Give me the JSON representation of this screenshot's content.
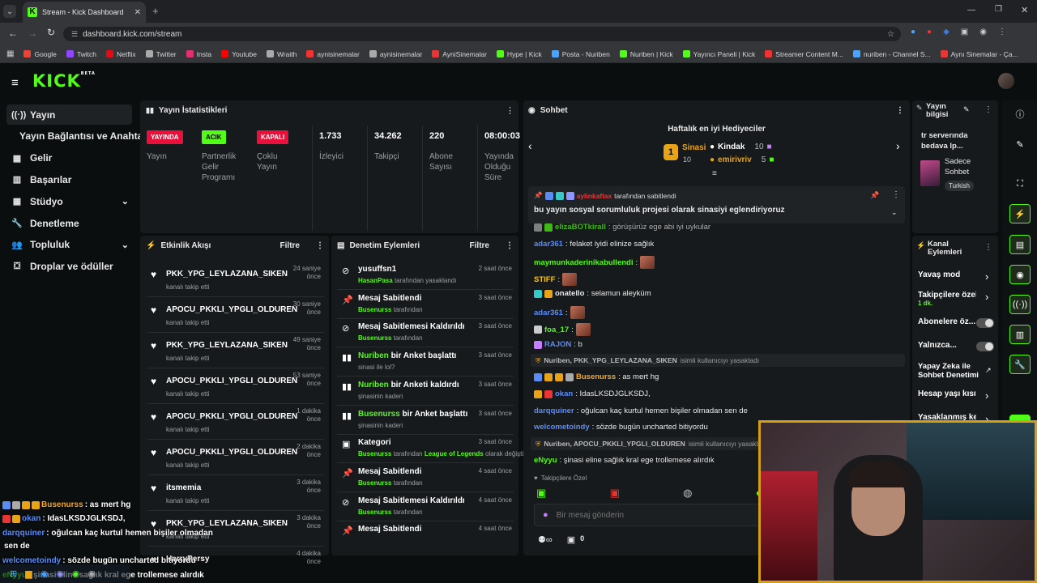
{
  "browser": {
    "tab_title": "Stream - Kick Dashboard",
    "url": "dashboard.kick.com/stream",
    "bookmarks": [
      "Google",
      "Twitch",
      "Netflix",
      "Twitter",
      "Insta",
      "Youtube",
      "Wraith",
      "aynisinemalar",
      "aynisinemalar",
      "AyniSinemalar",
      "Hype | Kick",
      "Posta - Nuriben",
      "Nuriben | Kick",
      "Yayıncı Paneli | Kick",
      "Streamer Content M...",
      "nuriben - Channel S...",
      "Aynı Sinemalar - Ça..."
    ]
  },
  "logo": {
    "text": "KICK",
    "beta": "BETA"
  },
  "sidebar": {
    "items": [
      {
        "label": "Yayın",
        "icon": "broadcast-icon"
      },
      {
        "label": "Yayın Bağlantısı ve Anahtarı",
        "icon": ""
      },
      {
        "label": "Gelir",
        "icon": "chart-icon"
      },
      {
        "label": "Başarılar",
        "icon": "trophy-icon"
      },
      {
        "label": "Stüdyo",
        "icon": "studio-icon"
      },
      {
        "label": "Denetleme",
        "icon": "wrench-icon"
      },
      {
        "label": "Topluluk",
        "icon": "people-icon"
      },
      {
        "label": "Droplar ve ödüller",
        "icon": "gift-icon"
      }
    ]
  },
  "stats": {
    "title": "Yayın İstatistikleri",
    "items": [
      {
        "tag": "YAYINDA",
        "label": "Yayın",
        "color": "#e9113c"
      },
      {
        "tag": "ACIK",
        "label": "Partnerlik Gelir Programı",
        "color": "#53fc18"
      },
      {
        "tag": "KAPALI",
        "label": "Çoklu Yayın",
        "color": "#e9113c"
      },
      {
        "value": "1.733",
        "label": "İzleyici"
      },
      {
        "value": "34.262",
        "label": "Takipçi"
      },
      {
        "value": "220",
        "label": "Abone Sayısı"
      },
      {
        "value": "08:00:03",
        "label": "Yayında Olduğu Süre"
      }
    ]
  },
  "activity": {
    "title": "Etkinlik Akışı",
    "filter": "Filtre",
    "events": [
      {
        "name": "PKK_YPG_LEYLAZANA_SIKEN",
        "sub": "kanalı takip etti",
        "time": "24 saniye önce"
      },
      {
        "name": "APOCU_PKKLI_YPGLI_OLDUREN",
        "sub": "kanalı takip etti",
        "time": "30 saniye önce"
      },
      {
        "name": "PKK_YPG_LEYLAZANA_SIKEN",
        "sub": "kanalı takip etti",
        "time": "49 saniye önce"
      },
      {
        "name": "APOCU_PKKLI_YPGLI_OLDUREN",
        "sub": "kanalı takip etti",
        "time": "53 saniye önce"
      },
      {
        "name": "APOCU_PKKLI_YPGLI_OLDUREN",
        "sub": "kanalı takip etti",
        "time": "1 dakika önce"
      },
      {
        "name": "APOCU_PKKLI_YPGLI_OLDUREN",
        "sub": "kanalı takip etti",
        "time": "2 dakika önce"
      },
      {
        "name": "itsmemia",
        "sub": "kanalı takip etti",
        "time": "3 dakika önce"
      },
      {
        "name": "PKK_YPG_LEYLAZANA_SIKEN",
        "sub": "kanalı takip etti",
        "time": "3 dakika önce"
      },
      {
        "name": "HarryPersy",
        "sub": "",
        "time": "4 dakika önce"
      }
    ]
  },
  "moderation": {
    "title": "Denetim Eylemleri",
    "filter": "Filtre",
    "actions": [
      {
        "icon": "ban-icon",
        "name": "yusuffsn1",
        "actor": "HasanPasa",
        "rest": "tarafından yasaklandı",
        "time": "2 saat önce"
      },
      {
        "icon": "pin-icon",
        "name": "Mesaj Sabitlendi",
        "actor": "Busenurss",
        "rest": "tarafından",
        "time": "3 saat önce"
      },
      {
        "icon": "unpin-icon",
        "name": "Mesaj Sabitlemesi Kaldırıldı",
        "actor": "Busenurss",
        "rest": "tarafından",
        "time": "3 saat önce"
      },
      {
        "icon": "poll-icon",
        "name": "bir Anket başlattı",
        "actor_name": "Nuriben",
        "sub": "sinasi ile lol?",
        "time": "3 saat önce"
      },
      {
        "icon": "poll-icon",
        "name": "bir Anketi kaldırdı",
        "actor_name": "Nuriben",
        "sub": "şinasinin kaderi",
        "time": "3 saat önce"
      },
      {
        "icon": "poll-icon",
        "name": "bir Anket başlattı",
        "actor_name": "Busenurss",
        "sub": "şinasinin kaderi",
        "time": "3 saat önce"
      },
      {
        "icon": "category-icon",
        "name": "Kategori",
        "actor": "Busenurss",
        "rest": "tarafından",
        "game": "League of Legends",
        "rest2": "olarak değiştirildi",
        "time": "3 saat önce"
      },
      {
        "icon": "pin-icon",
        "name": "Mesaj Sabitlendi",
        "actor": "Busenurss",
        "rest": "tarafından",
        "time": "4 saat önce"
      },
      {
        "icon": "unpin-icon",
        "name": "Mesaj Sabitlemesi Kaldırıldı",
        "actor": "Busenurss",
        "rest": "tarafından",
        "time": "4 saat önce"
      },
      {
        "icon": "pin-icon",
        "name": "Mesaj Sabitlendi",
        "actor": "",
        "rest": "",
        "time": "4 saat önce"
      }
    ]
  },
  "chat": {
    "title": "Sohbet",
    "gifters_title": "Haftalık en iyi Hediyeciler",
    "gifters": [
      {
        "name": "Sinasi",
        "count": "10"
      },
      {
        "name": "Kindak",
        "count": "10"
      },
      {
        "name": "emirivriv",
        "count": "5"
      }
    ],
    "pinned_by": "aylinkaflax",
    "pinned_by_rest": "tarafından sabitlendi",
    "pinned_text": "bu yayın sosyal sorumluluk projesi olarak sinasiyi eglendiriyoruz",
    "messages": [
      {
        "user": "elizaBOTkirall",
        "color": "#53fc18",
        "text": ": görüşürüz ege abi iyi uykular"
      },
      {
        "user": "adar361",
        "color": "#5b8cf5",
        "text": ": felaket iyidi elinize sağlık"
      },
      {
        "user": "maymunkaderinikabullendi",
        "color": "#53fc18",
        "text": ":"
      },
      {
        "user": "STIFF",
        "color": "#f5c518",
        "text": ":"
      },
      {
        "user": "onatello",
        "color": "#e8e8e8",
        "text": ": selamun aleyküm"
      },
      {
        "user": "adar361",
        "color": "#5b8cf5",
        "text": ":"
      },
      {
        "user": "foa_17",
        "color": "#53fc18",
        "text": ":"
      },
      {
        "user": "RAJON",
        "color": "#5b8cf5",
        "text": ": b"
      },
      {
        "system": true,
        "text": "Nuriben, PKK_YPG_LEYLAZANA_SIKEN",
        "rest": "isimli kullanıcıyı yasakladı"
      },
      {
        "user": "Busenurss",
        "color": "#f5a623",
        "text": ": as mert hg"
      },
      {
        "user": "okan",
        "color": "#5b8cf5",
        "text": ": IdasLKSDJGLKSDJ,"
      },
      {
        "user": "darqquiner",
        "color": "#5b8cf5",
        "text": ": oğulcan kaç kurtul hemen bişiler olmadan sen de"
      },
      {
        "user": "welcometoindy",
        "color": "#5b8cf5",
        "text": ": sözde bugün uncharted bitiyordu"
      },
      {
        "system": true,
        "text": "Nuriben, APOCU_PKKLI_YPGLI_OLDUREN",
        "rest": "isimli kullanıcıyı yasakladı"
      },
      {
        "user": "eNyyu",
        "color": "#53fc18",
        "text": ": şinasi eline sağlık kral ege trollemese alırdık"
      }
    ],
    "followers_only": "Takipçilere Özel",
    "input_placeholder": "Bir mesaj gönderin",
    "points": "0"
  },
  "stream_info": {
    "title": "Yayın bilgisi",
    "text": "tr serverında bedava lp...",
    "category": "Sadece Sohbet",
    "tag": "Turkish"
  },
  "channel_actions": {
    "title": "Kanal Eylemleri",
    "items": [
      {
        "label": "Yavaş mod",
        "type": "arrow"
      },
      {
        "label": "Takipçilere özel s",
        "sub": "1 dk.",
        "type": "arrow"
      },
      {
        "label": "Abonelere öz...",
        "type": "toggle"
      },
      {
        "label": "Yalnızca...",
        "type": "toggle"
      },
      {
        "label": "Yapay Zeka ile Sohbet Denetimi",
        "type": "link"
      },
      {
        "label": "Hesap yaşı kısıtla",
        "type": "arrow"
      },
      {
        "label": "Yasaklanmış kelin",
        "type": "arrow"
      }
    ]
  },
  "overlay_chat": [
    {
      "user": "Busenurss",
      "color": "#f5a623",
      "text": ": as mert hg"
    },
    {
      "user": "okan",
      "color": "#5b8cf5",
      "text": ": IdasLKSDJGLKSDJ,"
    },
    {
      "user": "darqquiner",
      "color": "#5b8cf5",
      "text": ": oğulcan kaç kurtul hemen bişiler olmadan"
    },
    {
      "user": "",
      "color": "#ffffff",
      "text": "sen de"
    },
    {
      "user": "welcometoindy",
      "color": "#5b8cf5",
      "text": ": sözde bugün uncharted bitiyordu"
    },
    {
      "user": "eNyyu",
      "color": "#53fc18",
      "text": ": şinasi eline sağlık kral ege trollemese alırdık"
    }
  ]
}
